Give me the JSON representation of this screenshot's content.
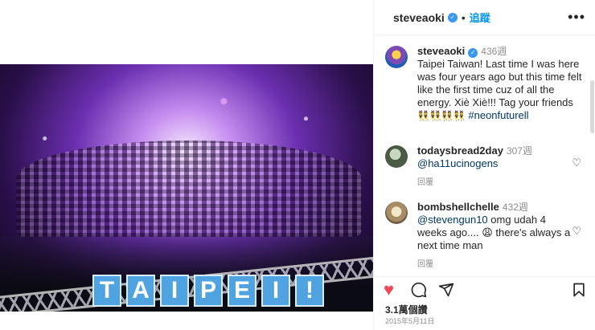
{
  "post": {
    "username": "steveaoki",
    "follow_label": "追蹤",
    "caption_username": "steveaoki",
    "caption_age": "436週",
    "caption_text": "Taipei Taiwan! Last time I was here was four years ago but this time felt like the first time cuz of all the energy. Xiè Xiè!!! Tag your friends",
    "caption_emojis": "👯👯👯👯",
    "hashtag": "#neonfuturell",
    "sign_letters": [
      "T",
      "A",
      "I",
      "P",
      "E",
      "I",
      "!"
    ],
    "likes_label": "3.1萬個讚",
    "date": "2015年5月11日"
  },
  "comments": [
    {
      "username": "todaysbread2day",
      "age": "307週",
      "mention": "@ha11ucinogens",
      "text": "",
      "reply_label": "回覆"
    },
    {
      "username": "bombshellchelle",
      "age": "432週",
      "mention": "@stevengun10",
      "text": " omg udah 4 weeks ago.... 😩 there's always a next time man",
      "reply_label": "回覆"
    }
  ],
  "icons": {
    "verified": "verified-badge-icon",
    "more": "more-options-icon",
    "like": "heart-filled-icon",
    "comment": "comment-bubble-icon",
    "share": "paper-plane-icon",
    "save": "bookmark-icon"
  },
  "colors": {
    "like": "#ed4956",
    "link": "#0095f6",
    "verified": "#3897f0"
  }
}
